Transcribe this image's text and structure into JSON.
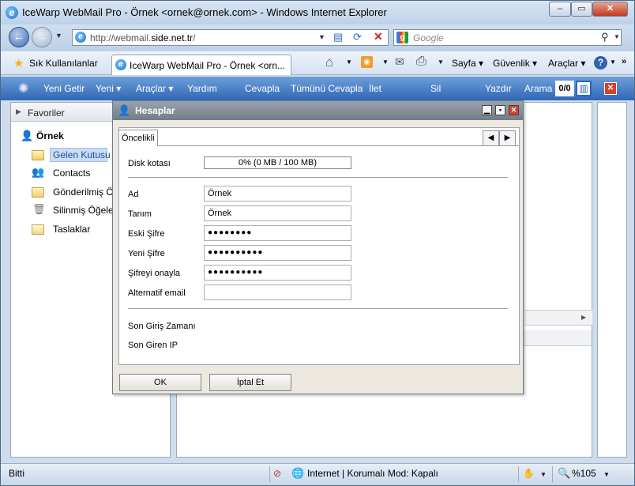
{
  "window": {
    "title": "IceWarp WebMail Pro - Örnek <ornek@ornek.com> - Windows Internet Explorer",
    "controls": {
      "minimize": "–",
      "maximize": "▭",
      "close": "✕"
    }
  },
  "addressbar": {
    "url_prefix": "http://webmail.",
    "url_domain": "side.net.tr",
    "url_suffix": "/",
    "search_placeholder": "Google"
  },
  "favbar": {
    "favorites_label": "Sık Kullanılanlar",
    "tab_title": "IceWarp WebMail Pro - Örnek <orn...",
    "page_menu": "Sayfa",
    "safety_menu": "Güvenlik",
    "tools_menu": "Araçlar"
  },
  "webmail_toolbar": {
    "new_fetch": "Yeni Getir",
    "new": "Yeni",
    "tools": "Araçlar",
    "help": "Yardım",
    "reply": "Cevapla",
    "reply_all": "Tümünü Cevapla",
    "forward": "İlet",
    "delete": "Sil",
    "print": "Yazdır",
    "search": "Arama",
    "counter": "0/0"
  },
  "sidebar": {
    "header": "Favoriler",
    "account": "Örnek",
    "folders": [
      {
        "label": "Gelen Kutusu",
        "icon": "inbox-icon"
      },
      {
        "label": "Contacts",
        "icon": "contacts-icon"
      },
      {
        "label": "Gönderilmiş Öğe",
        "icon": "sent-icon"
      },
      {
        "label": "Silinmiş Öğeler",
        "icon": "trash-icon"
      },
      {
        "label": "Taslaklar",
        "icon": "drafts-icon"
      }
    ]
  },
  "dialog": {
    "title": "Hesaplar",
    "tab": "Öncelikli",
    "disk_quota_label": "Disk kotası",
    "disk_quota_value": "0% (0 MB / 100 MB)",
    "disk_quota_fraction": 0,
    "name_label": "Ad",
    "name_value": "Örnek",
    "desc_label": "Tanım",
    "desc_value": "Örnek",
    "old_pw_label": "Eski Şifre",
    "old_pw_value": "●●●●●●●●",
    "new_pw_label": "Yeni Şifre",
    "new_pw_value": "●●●●●●●●●●",
    "confirm_pw_label": "Şifreyi onayla",
    "confirm_pw_value": "●●●●●●●●●●",
    "alt_email_label": "Alternatif email",
    "alt_email_value": "",
    "last_login_label": "Son Giriş Zamanı",
    "last_ip_label": "Son Giren IP",
    "ok": "OK",
    "cancel": "İptal Et"
  },
  "statusbar": {
    "status": "Bitti",
    "zone": "Internet | Korumalı Mod: Kapalı",
    "zoom": "%105"
  }
}
